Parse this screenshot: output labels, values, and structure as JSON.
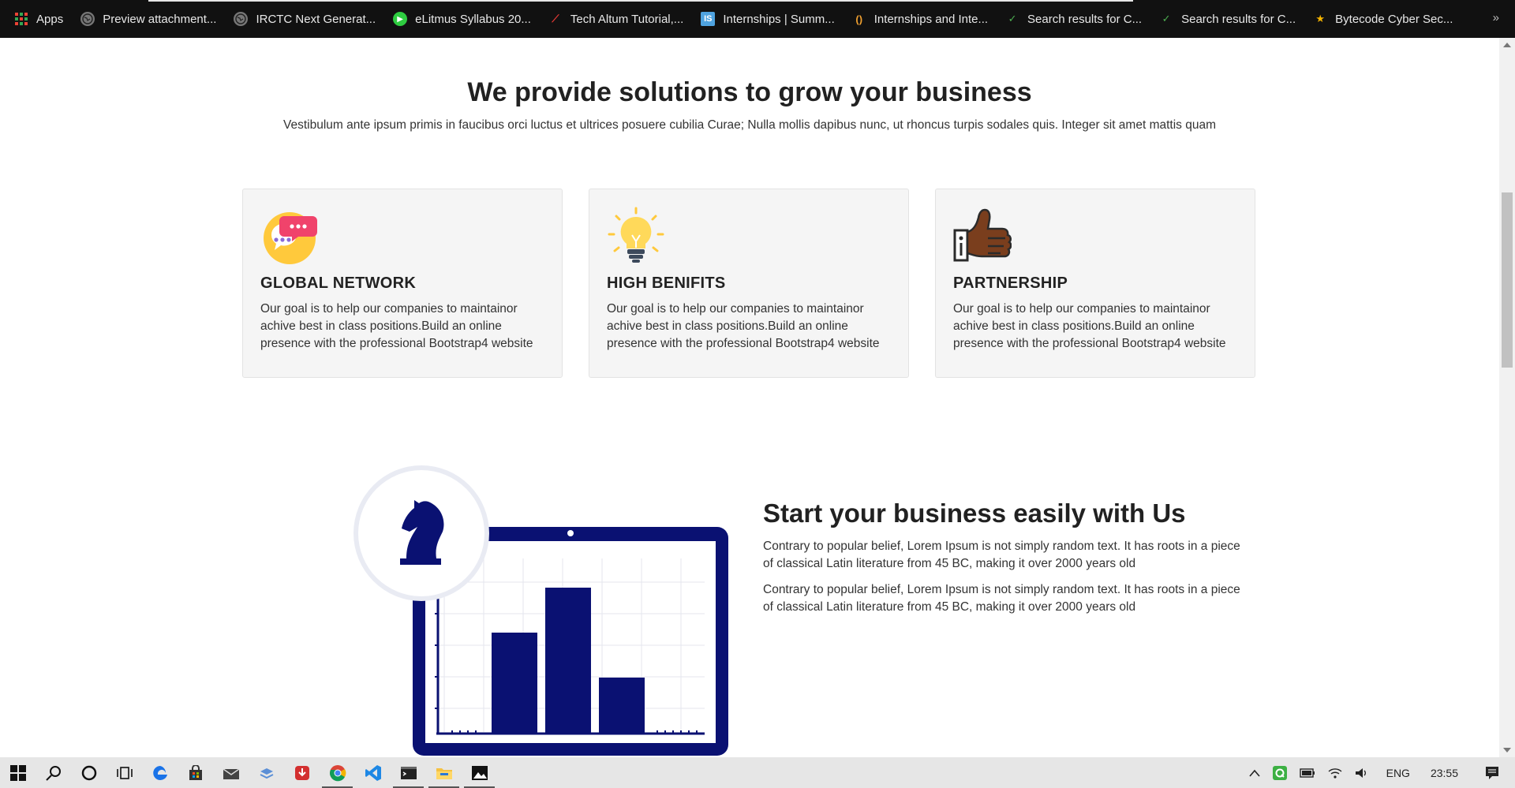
{
  "bookmarks": [
    {
      "label": "Apps",
      "icon": "apps-grid-icon",
      "color": "#e74c3c"
    },
    {
      "label": "Preview attachment...",
      "icon": "globe-icon",
      "color": "#888888"
    },
    {
      "label": "IRCTC Next Generat...",
      "icon": "globe-icon",
      "color": "#888888"
    },
    {
      "label": "eLitmus Syllabus 20...",
      "icon": "elitmus-icon",
      "color": "#2ecc40"
    },
    {
      "label": "Tech Altum Tutorial,...",
      "icon": "techaltum-icon",
      "color": "#e53935"
    },
    {
      "label": "Internships | Summ...",
      "icon": "internshala-icon",
      "color": "#4fa3e0"
    },
    {
      "label": "Internships and Inte...",
      "icon": "bracket-icon",
      "color": "#f0a030"
    },
    {
      "label": "Search results for C...",
      "icon": "check-icon",
      "color": "#4caf50"
    },
    {
      "label": "Search results for C...",
      "icon": "check-icon",
      "color": "#4caf50"
    },
    {
      "label": "Bytecode Cyber Sec...",
      "icon": "star-icon",
      "color": "#f5b400"
    }
  ],
  "bookmarks_more": "»",
  "hero": {
    "title": "We provide solutions to grow your business",
    "subtitle": "Vestibulum ante ipsum primis in faucibus orci luctus et ultrices posuere cubilia Curae; Nulla mollis dapibus nunc, ut rhoncus turpis sodales quis. Integer sit amet mattis quam"
  },
  "cards": [
    {
      "title": "GLOBAL NETWORK",
      "text": "Our goal is to help our companies to maintainor achive best in class positions.Build an online presence with the professional Bootstrap4 website",
      "icon": "chat-bubbles-icon"
    },
    {
      "title": "HIGH BENIFITS",
      "text": "Our goal is to help our companies to maintainor achive best in class positions.Build an online presence with the professional Bootstrap4 website",
      "icon": "lightbulb-icon"
    },
    {
      "title": "PARTNERSHIP",
      "text": "Our goal is to help our companies to maintainor achive best in class positions.Build an online presence with the professional Bootstrap4 website",
      "icon": "thumbs-up-icon"
    }
  ],
  "section": {
    "title": "Start your business easily with Us",
    "paragraphs": [
      "Contrary to popular belief, Lorem Ipsum is not simply random text. It has roots in a piece of classical Latin literature from 45 BC, making it over 2000 years old",
      "Contrary to popular belief, Lorem Ipsum is not simply random text. It has roots in a piece of classical Latin literature from 45 BC, making it over 2000 years old"
    ]
  },
  "colors": {
    "navy": "#0a1172",
    "accent_pink": "#f0436b",
    "accent_yellow": "#ffc93c"
  },
  "taskbar": {
    "apps": [
      "start-icon",
      "search-icon",
      "cortana-icon",
      "task-view-icon",
      "edge-icon",
      "store-icon",
      "mail-icon",
      "files-icon",
      "downloader-icon",
      "chrome-icon",
      "vscode-icon",
      "terminal-icon",
      "file-explorer-icon",
      "photos-icon"
    ],
    "language": "ENG",
    "time": "23:55"
  }
}
